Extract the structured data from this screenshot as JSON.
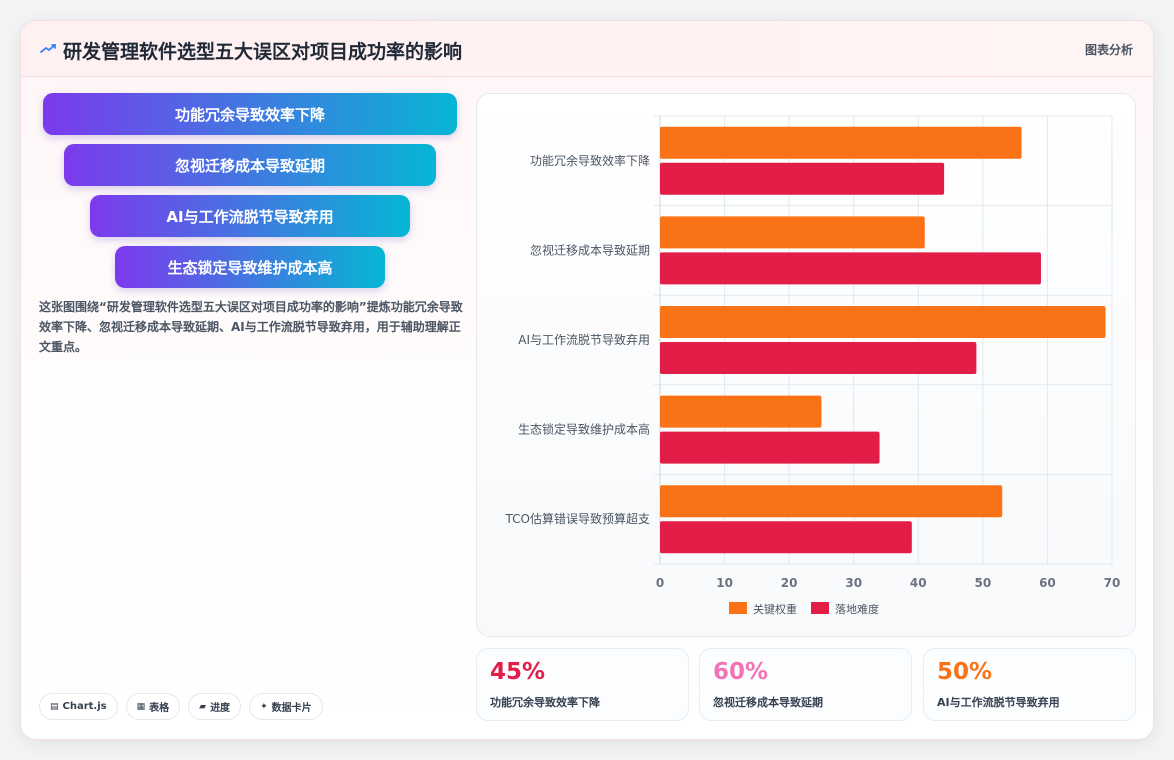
{
  "header": {
    "title": "研发管理软件选型五大误区对项目成功率的影响",
    "tag": "图表分析"
  },
  "funnel": [
    "功能冗余导致效率下降",
    "忽视迁移成本导致延期",
    "AI与工作流脱节导致弃用",
    "生态锁定导致维护成本高"
  ],
  "description": "这张图围绕“研发管理软件选型五大误区对项目成功率的影响”提炼功能冗余导致效率下降、忽视迁移成本导致延期、AI与工作流脱节导致弃用，用于辅助理解正文重点。",
  "chips": [
    {
      "icon": "▤",
      "label": "Chart.js"
    },
    {
      "icon": "▦",
      "label": "表格"
    },
    {
      "icon": "▰",
      "label": "进度"
    },
    {
      "icon": "✦",
      "label": "数据卡片"
    }
  ],
  "stats": [
    {
      "value": "45%",
      "label": "功能冗余导致效率下降",
      "color": "#e11d48"
    },
    {
      "value": "60%",
      "label": "忽视迁移成本导致延期",
      "color": "#f472b6"
    },
    {
      "value": "50%",
      "label": "AI与工作流脱节导致弃用",
      "color": "#f97316"
    }
  ],
  "chart_data": {
    "type": "bar",
    "orientation": "horizontal",
    "categories": [
      "功能冗余导致效率下降",
      "忽视迁移成本导致延期",
      "AI与工作流脱节导致弃用",
      "生态锁定导致维护成本高",
      "TCO估算错误导致预算超支"
    ],
    "series": [
      {
        "name": "关键权重",
        "color": "#f97316",
        "values": [
          56,
          41,
          69,
          25,
          53
        ]
      },
      {
        "name": "落地难度",
        "color": "#e11d48",
        "values": [
          44,
          59,
          49,
          34,
          39
        ]
      }
    ],
    "xlim": [
      0,
      70
    ],
    "xticks": [
      0,
      10,
      20,
      30,
      40,
      50,
      60,
      70
    ],
    "grid": true,
    "legend": "bottom"
  }
}
